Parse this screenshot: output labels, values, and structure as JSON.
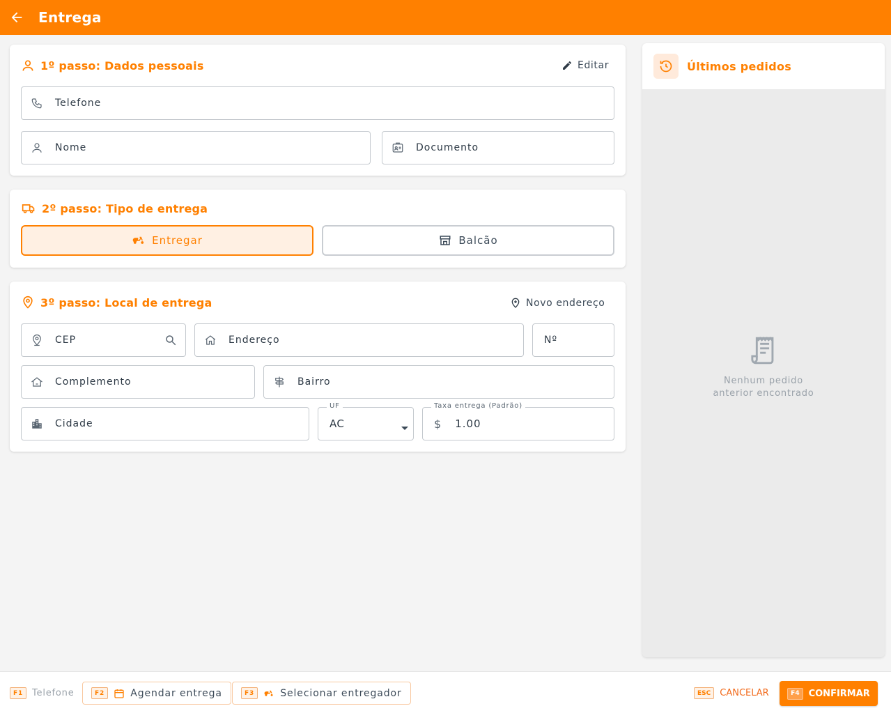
{
  "header": {
    "title": "Entrega"
  },
  "step1": {
    "title": "1º passo: Dados pessoais",
    "edit_label": "Editar",
    "phone_placeholder": "Telefone",
    "name_placeholder": "Nome",
    "document_placeholder": "Documento"
  },
  "step2": {
    "title": "2º passo: Tipo de entrega",
    "options": [
      {
        "label": "Entregar",
        "selected": true
      },
      {
        "label": "Balcão",
        "selected": false
      }
    ]
  },
  "step3": {
    "title": "3º passo: Local de entrega",
    "new_address_label": "Novo endereço",
    "cep_placeholder": "CEP",
    "address_placeholder": "Endereço",
    "number_placeholder": "Nº",
    "complement_placeholder": "Complemento",
    "neighborhood_placeholder": "Bairro",
    "city_placeholder": "Cidade",
    "uf_label": "UF",
    "uf_value": "AC",
    "fee_label": "Taxa entrega (Padrão)",
    "fee_currency": "$",
    "fee_value": "1.00"
  },
  "sidebar": {
    "title": "Últimos pedidos",
    "empty_line1": "Nenhum pedido",
    "empty_line2": "anterior encontrado"
  },
  "footer": {
    "phone": {
      "key": "F1",
      "label": "Telefone"
    },
    "schedule": {
      "key": "F2",
      "label": "Agendar entrega"
    },
    "courier": {
      "key": "F3",
      "label": "Selecionar entregador"
    },
    "cancel": {
      "key": "ESC",
      "label": "CANCELAR"
    },
    "confirm": {
      "key": "F4",
      "label": "CONFIRMAR"
    }
  },
  "colors": {
    "accent": "#ff8000",
    "accent_light": "#fff0e3",
    "text": "#3c4a58",
    "cancel": "#f26a1b"
  },
  "icons": [
    "arrow-left-icon",
    "user-icon",
    "pencil-icon",
    "phone-icon",
    "id-card-icon",
    "truck-icon",
    "scooter-icon",
    "store-icon",
    "map-pin-icon",
    "map-pin-plus-icon",
    "search-icon",
    "home-icon",
    "house-outline-icon",
    "signpost-icon",
    "buildings-icon",
    "caret-down-icon",
    "history-icon",
    "receipt-icon",
    "calendar-icon"
  ]
}
